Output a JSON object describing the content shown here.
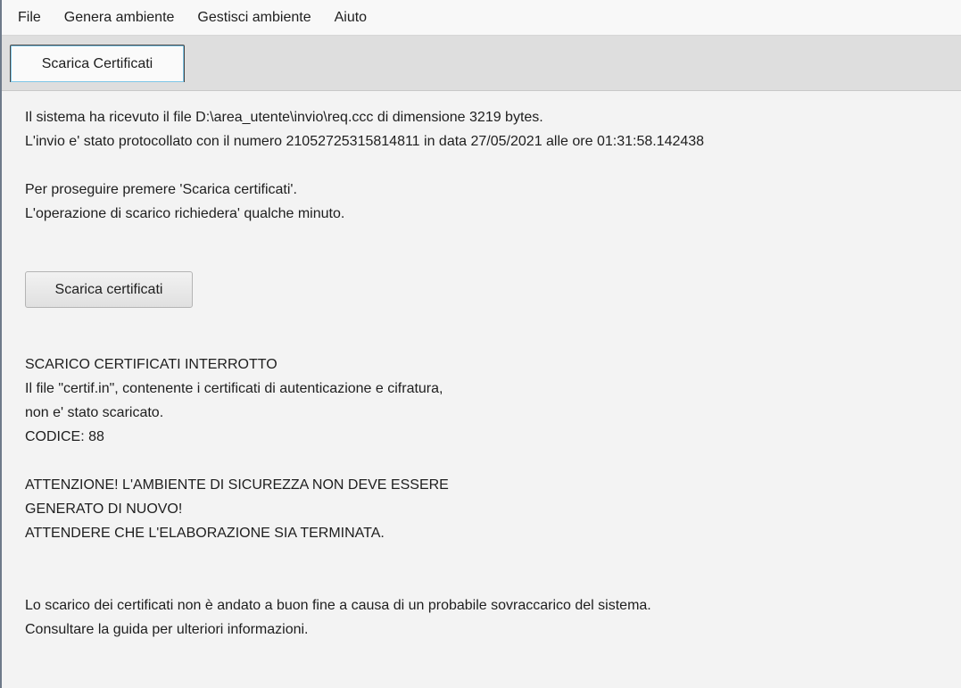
{
  "menubar": {
    "items": [
      "File",
      "Genera ambiente",
      "Gestisci ambiente",
      "Aiuto"
    ]
  },
  "tabs": [
    {
      "label": "Scarica Certificati"
    }
  ],
  "main": {
    "info_lines": [
      "Il sistema ha ricevuto il file D:\\area_utente\\invio\\req.ccc di dimensione 3219 bytes.",
      "L'invio e' stato protocollato con il numero 21052725315814811 in data 27/05/2021 alle ore 01:31:58.142438"
    ],
    "instruction_lines": [
      "Per proseguire premere 'Scarica certificati'.",
      "L'operazione di scarico richiedera' qualche minuto."
    ],
    "button_label": "Scarica certificati",
    "error_lines": [
      "SCARICO CERTIFICATI INTERROTTO",
      "Il file \"certif.in\", contenente i certificati di autenticazione e cifratura,",
      "non e' stato scaricato.",
      "CODICE: 88"
    ],
    "warning_lines": [
      "ATTENZIONE! L'AMBIENTE DI SICUREZZA NON DEVE ESSERE",
      "GENERATO DI NUOVO!",
      "ATTENDERE CHE L'ELABORAZIONE SIA TERMINATA."
    ],
    "footer_lines": [
      "Lo scarico dei certificati non è andato a buon fine a causa di un probabile sovraccarico del sistema.",
      "Consultare la guida per ulteriori informazioni."
    ]
  }
}
